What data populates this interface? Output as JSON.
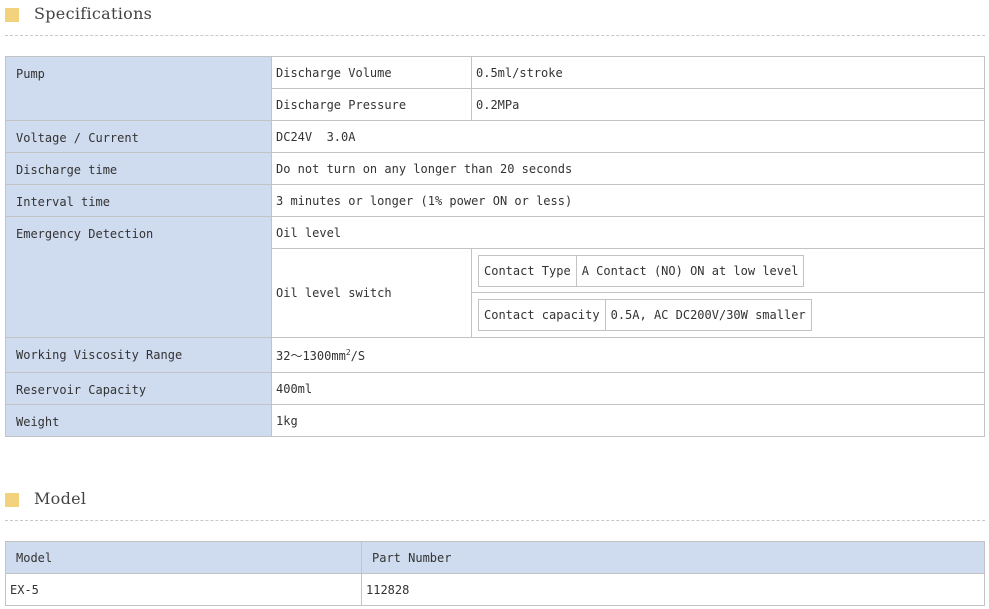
{
  "sections": {
    "specifications": "Specifications",
    "model": "Model"
  },
  "spec": {
    "pump": {
      "label": "Pump",
      "rows": [
        {
          "name": "Discharge Volume",
          "value": "0.5ml/stroke"
        },
        {
          "name": "Discharge Pressure",
          "value": "0.2MPa"
        }
      ]
    },
    "voltage": {
      "label": "Voltage / Current",
      "value": "DC24V  3.0A"
    },
    "discharge_time": {
      "label": "Discharge time",
      "value": "Do not turn on any longer than 20 seconds"
    },
    "interval_time": {
      "label": "Interval time",
      "value": "3 minutes or longer (1% power ON or less)"
    },
    "emergency": {
      "label": "Emergency Detection",
      "oil_level": "Oil level",
      "switch_label": "Oil level switch",
      "contact_type_label": "Contact Type",
      "contact_type_value": "A Contact (NO) ON at low level",
      "contact_capacity_label": "Contact capacity",
      "contact_capacity_value": "0.5A, AC DC200V/30W smaller"
    },
    "viscosity": {
      "label": "Working Viscosity Range",
      "value_main": "32～1300mm",
      "value_sup": "2",
      "value_tail": "/S"
    },
    "reservoir": {
      "label": "Reservoir Capacity",
      "value": "400ml"
    },
    "weight": {
      "label": "Weight",
      "value": "1kg"
    }
  },
  "model_table": {
    "headers": [
      "Model",
      "Part Number"
    ],
    "rows": [
      [
        "EX-5",
        "112828"
      ]
    ]
  }
}
